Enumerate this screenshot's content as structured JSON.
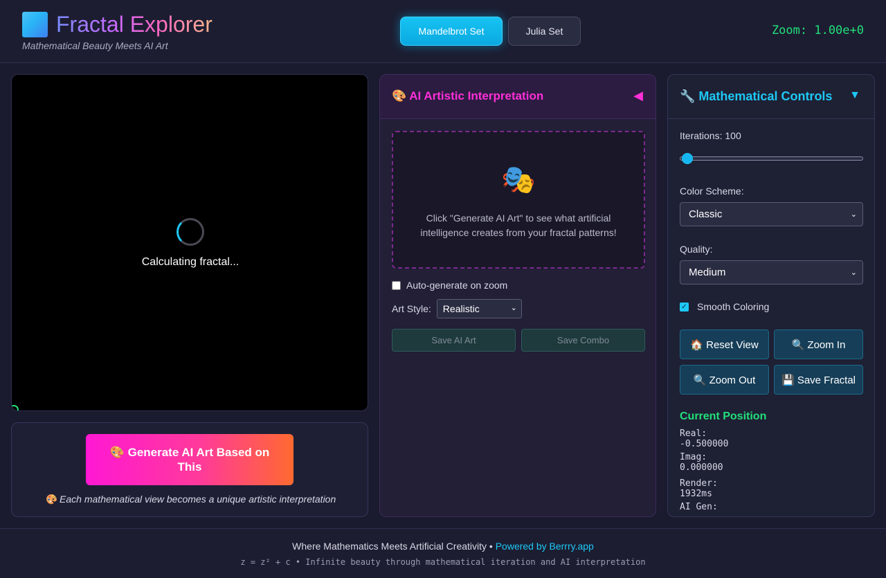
{
  "header": {
    "title": "Fractal Explorer",
    "subtitle": "Mathematical Beauty Meets AI Art",
    "modes": [
      {
        "label": "Mandelbrot Set",
        "active": true
      },
      {
        "label": "Julia Set",
        "active": false
      }
    ],
    "zoom_text": "Zoom: 1.00e+0"
  },
  "canvas": {
    "loading_text": "Calculating fractal..."
  },
  "generate": {
    "button_label": "🎨 Generate AI Art Based on This",
    "note": "🎨 Each mathematical view becomes a unique artistic interpretation"
  },
  "ai_panel": {
    "title": "🎨 AI Artistic Interpretation",
    "collapse_glyph": "◀",
    "placeholder_icon": "🎭",
    "placeholder_text": "Click \"Generate AI Art\" to see what artificial intelligence creates from your fractal patterns!",
    "auto_generate_label": "Auto-generate on zoom",
    "auto_generate_checked": false,
    "art_style_label": "Art Style:",
    "art_style_value": "Realistic",
    "save_ai_label": "Save AI Art",
    "save_combo_label": "Save Combo"
  },
  "controls": {
    "title": "🔧 Mathematical Controls",
    "collapse_glyph": "▼",
    "iterations_label": "Iterations: 100",
    "iterations_value": 100,
    "color_scheme_label": "Color Scheme:",
    "color_scheme_value": "Classic",
    "quality_label": "Quality:",
    "quality_value": "Medium",
    "smooth_label": "Smooth Coloring",
    "smooth_checked": true,
    "buttons": {
      "reset": "🏠 Reset View",
      "zoom_in": "🔍 Zoom In",
      "zoom_out": "🔍 Zoom Out",
      "save": "💾 Save Fractal"
    },
    "position": {
      "title": "Current Position",
      "real_label": "Real:",
      "real_value": "-0.500000",
      "imag_label": "Imag:",
      "imag_value": "0.000000",
      "render_label": "Render:",
      "render_value": "1932ms",
      "ai_gen_label": "AI Gen:"
    }
  },
  "footer": {
    "line1_text": "Where Mathematics Meets Artificial Creativity • ",
    "line1_link": "Powered by Berrry.app",
    "line2": "z = z² + c • Infinite beauty through mathematical iteration and AI interpretation"
  },
  "colors": {
    "accent_cyan": "#1ec8f5",
    "accent_magenta": "#ff2fd8",
    "accent_green": "#22e07a",
    "background": "#1a1b2e"
  }
}
